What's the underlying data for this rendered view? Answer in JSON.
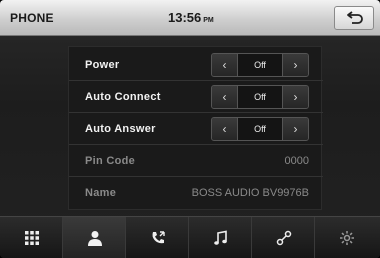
{
  "header": {
    "title": "PHONE",
    "time": "13:56",
    "ampm": "PM"
  },
  "settings": [
    {
      "label": "Power",
      "type": "toggle",
      "value": "Off"
    },
    {
      "label": "Auto Connect",
      "type": "toggle",
      "value": "Off"
    },
    {
      "label": "Auto Answer",
      "type": "toggle",
      "value": "Off"
    },
    {
      "label": "Pin Code",
      "type": "text",
      "value": "0000"
    },
    {
      "label": "Name",
      "type": "text",
      "value": "BOSS AUDIO BV9976B"
    }
  ],
  "dock": {
    "items": [
      "apps-grid-icon",
      "contacts-icon",
      "call-log-icon",
      "music-icon",
      "bluetooth-link-icon",
      "settings-gear-icon"
    ],
    "active_index": 1
  }
}
